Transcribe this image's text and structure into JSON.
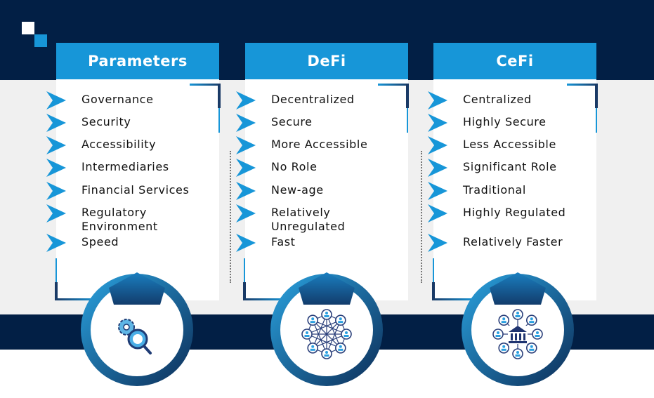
{
  "columns": [
    {
      "id": "parameters",
      "title": "Parameters",
      "icon": "gear-magnifier-icon",
      "items": [
        "Governance",
        "Security",
        "Accessibility",
        "Intermediaries",
        "Financial Services",
        "Regulatory Environment",
        "Speed"
      ]
    },
    {
      "id": "defi",
      "title": "DeFi",
      "icon": "decentralized-network-icon",
      "items": [
        "Decentralized",
        "Secure",
        "More Accessible",
        "No Role",
        "New-age",
        "Relatively Unregulated",
        "Fast"
      ]
    },
    {
      "id": "cefi",
      "title": "CeFi",
      "icon": "centralized-bank-network-icon",
      "items": [
        "Centralized",
        "Highly Secure",
        "Less Accessible",
        "Significant Role",
        "Traditional",
        "Highly Regulated",
        "Relatively Faster"
      ]
    }
  ],
  "colors": {
    "navy": "#021f45",
    "accent_blue": "#1796d8",
    "dark_blue": "#1a3a66",
    "gray_bg": "#f0f0f0"
  }
}
